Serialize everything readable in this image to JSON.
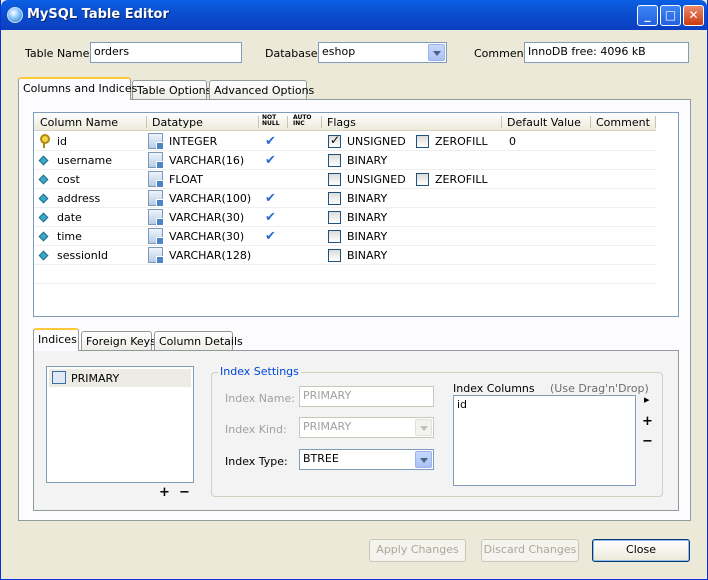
{
  "window": {
    "title": "MySQL Table Editor",
    "controls": {
      "minimize": "_",
      "maximize": "□",
      "close": "✕"
    }
  },
  "header": {
    "table_name_label": "Table Name:",
    "table_name_value": "orders",
    "database_label": "Database:",
    "database_value": "eshop",
    "comment_label": "Comment:",
    "comment_value": "InnoDB free: 4096 kB"
  },
  "tabs": [
    {
      "label": "Columns and Indices",
      "active": true
    },
    {
      "label": "Table Options",
      "active": false
    },
    {
      "label": "Advanced Options",
      "active": false
    }
  ],
  "columns_grid": {
    "headers": {
      "column_name": "Column Name",
      "datatype": "Datatype",
      "not_null_top": "NOT",
      "not_null_bottom": "NULL",
      "auto_inc_top": "AUTO",
      "auto_inc_bottom": "INC",
      "flags": "Flags",
      "default_value": "Default Value",
      "comment": "Comment"
    },
    "rows": [
      {
        "name": "id",
        "icon": "primary-key-icon",
        "datatype": "INTEGER",
        "not_null": true,
        "flag1": "UNSIGNED",
        "flag1_checked": true,
        "flag2": "ZEROFILL",
        "flag2_checked": false,
        "default": "0"
      },
      {
        "name": "username",
        "icon": "column-icon",
        "datatype": "VARCHAR(16)",
        "not_null": true,
        "flag1": "BINARY",
        "flag1_checked": false,
        "default": ""
      },
      {
        "name": "cost",
        "icon": "column-icon",
        "datatype": "FLOAT",
        "not_null": false,
        "flag1": "UNSIGNED",
        "flag1_checked": false,
        "flag2": "ZEROFILL",
        "flag2_checked": false,
        "default": ""
      },
      {
        "name": "address",
        "icon": "column-icon",
        "datatype": "VARCHAR(100)",
        "not_null": true,
        "flag1": "BINARY",
        "flag1_checked": false,
        "default": ""
      },
      {
        "name": "date",
        "icon": "column-icon",
        "datatype": "VARCHAR(30)",
        "not_null": true,
        "flag1": "BINARY",
        "flag1_checked": false,
        "default": ""
      },
      {
        "name": "time",
        "icon": "column-icon",
        "datatype": "VARCHAR(30)",
        "not_null": true,
        "flag1": "BINARY",
        "flag1_checked": false,
        "default": ""
      },
      {
        "name": "sessionId",
        "icon": "column-icon",
        "datatype": "VARCHAR(128)",
        "not_null": false,
        "flag1": "BINARY",
        "flag1_checked": false,
        "default": ""
      }
    ]
  },
  "subtabs": [
    {
      "label": "Indices",
      "active": true
    },
    {
      "label": "Foreign Keys",
      "active": false
    },
    {
      "label": "Column Details",
      "active": false
    }
  ],
  "indices": {
    "items": [
      "PRIMARY"
    ],
    "add": "+",
    "remove": "−"
  },
  "index_settings": {
    "title": "Index Settings",
    "name_label": "Index Name:",
    "name_value": "PRIMARY",
    "kind_label": "Index Kind:",
    "kind_value": "PRIMARY",
    "type_label": "Index Type:",
    "type_value": "BTREE",
    "columns_label": "Index Columns",
    "columns_hint": "(Use Drag'n'Drop)",
    "columns": [
      "id"
    ],
    "arrow": "▸",
    "add": "+",
    "remove": "−"
  },
  "footer": {
    "apply": "Apply Changes",
    "discard": "Discard Changes",
    "close": "Close"
  }
}
